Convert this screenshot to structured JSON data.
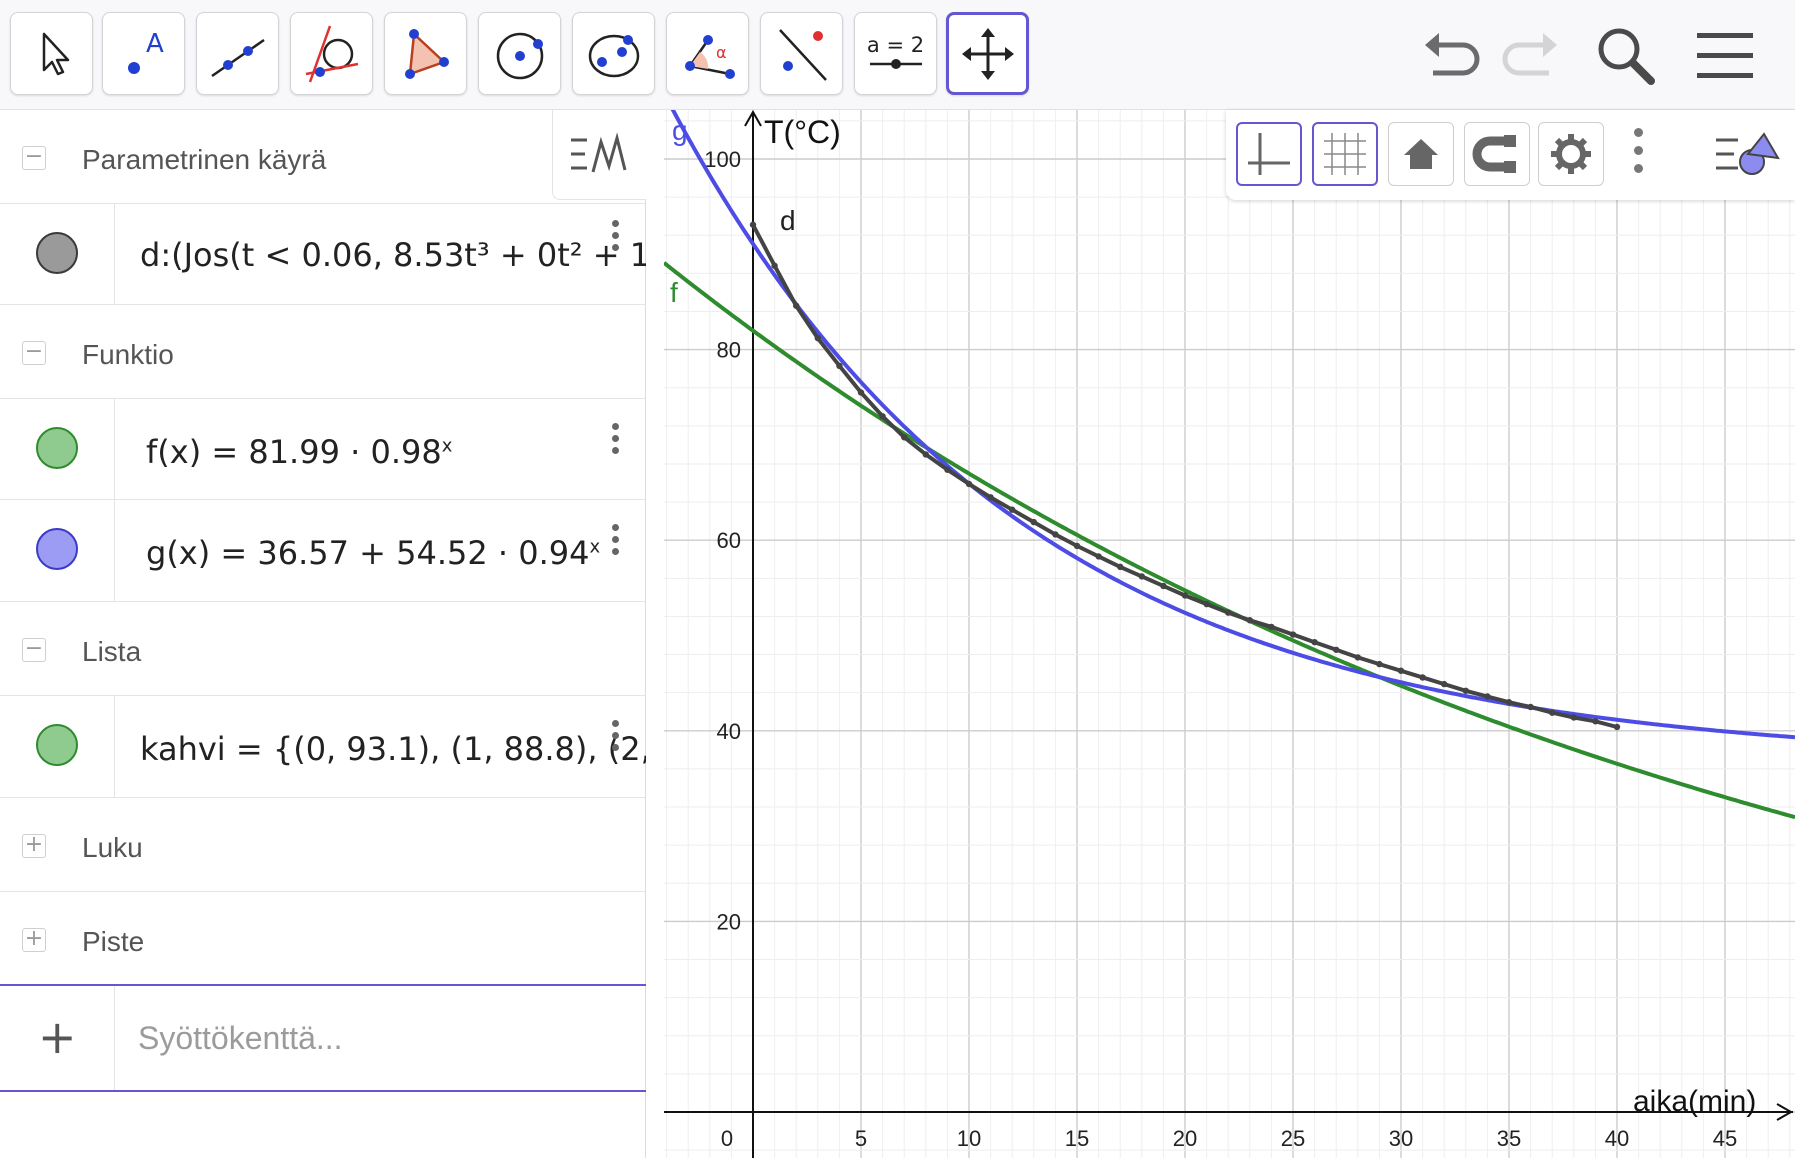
{
  "toolbar": {
    "tools": [
      {
        "name": "move-tool",
        "icon": "arrow-cursor-icon",
        "active": false
      },
      {
        "name": "point-tool",
        "icon": "point-icon",
        "active": false
      },
      {
        "name": "line-tool",
        "icon": "line-icon",
        "active": false
      },
      {
        "name": "tangent-tool",
        "icon": "tangent-icon",
        "active": false
      },
      {
        "name": "polygon-tool",
        "icon": "polygon-icon",
        "active": false
      },
      {
        "name": "circle-tool",
        "icon": "circle-icon",
        "active": false
      },
      {
        "name": "ellipse-tool",
        "icon": "ellipse-icon",
        "active": false
      },
      {
        "name": "angle-tool",
        "icon": "angle-icon",
        "active": false
      },
      {
        "name": "reflect-tool",
        "icon": "reflect-icon",
        "active": false
      },
      {
        "name": "slider-tool",
        "icon": "slider-icon",
        "active": false
      },
      {
        "name": "move-graphics-tool",
        "icon": "move-graphics-icon",
        "active": true
      }
    ],
    "slider_tool_text": "a = 2",
    "angle_tool_text": "α",
    "point_tool_text": "A"
  },
  "algebra": {
    "categories": {
      "parametric": "Parametrinen käyrä",
      "function": "Funktio",
      "list": "Lista",
      "number": "Luku",
      "point": "Piste"
    },
    "items": {
      "d": "d:(Jos(t < 0.06, 8.53t³ + 0t² + 1",
      "f_name": "f",
      "f_body": "(x)  =  81.99 · 0.98",
      "f_exp": "x",
      "g_name": "g",
      "g_body": "(x)  =  36.57 + 54.52 · 0.94",
      "g_exp": "x",
      "kahvi": "kahvi = {(0, 93.1), (1, 88.8), (2,"
    },
    "input_placeholder": "Syöttökenttä..."
  },
  "graph": {
    "x_axis_label": "aika(min)",
    "y_axis_label": "T(°C)",
    "x_ticks": [
      "0",
      "5",
      "10",
      "15",
      "20",
      "25",
      "30",
      "35",
      "40",
      "45"
    ],
    "y_ticks": [
      "20",
      "40",
      "60",
      "80",
      "100"
    ],
    "curve_labels": {
      "g": "g",
      "f": "f",
      "d": "d"
    },
    "colors": {
      "f": "#2e8b2e",
      "g": "#4d4de6",
      "d": "#444444",
      "axis": "#111111",
      "grid_major": "#cccccc",
      "grid_minor": "#eeeeee"
    },
    "functions": {
      "f": {
        "a": 81.99,
        "b": 0.98
      },
      "g": {
        "c": 36.57,
        "a": 54.52,
        "b": 0.94
      }
    },
    "data_points": [
      [
        0,
        93.1
      ],
      [
        1,
        88.8
      ],
      [
        2,
        84.6
      ],
      [
        3,
        81.2
      ],
      [
        4,
        78.3
      ],
      [
        5,
        75.5
      ],
      [
        6,
        73.0
      ],
      [
        7,
        70.8
      ],
      [
        8,
        69.0
      ],
      [
        9,
        67.4
      ],
      [
        10,
        65.9
      ],
      [
        11,
        64.5
      ],
      [
        12,
        63.2
      ],
      [
        13,
        61.9
      ],
      [
        14,
        60.6
      ],
      [
        15,
        59.4
      ],
      [
        16,
        58.3
      ],
      [
        17,
        57.2
      ],
      [
        18,
        56.2
      ],
      [
        19,
        55.2
      ],
      [
        20,
        54.2
      ],
      [
        21,
        53.3
      ],
      [
        22,
        52.4
      ],
      [
        23,
        51.6
      ],
      [
        24,
        50.9
      ],
      [
        25,
        50.1
      ],
      [
        26,
        49.3
      ],
      [
        27,
        48.5
      ],
      [
        28,
        47.7
      ],
      [
        29,
        47.0
      ],
      [
        30,
        46.3
      ],
      [
        31,
        45.6
      ],
      [
        32,
        44.9
      ],
      [
        33,
        44.2
      ],
      [
        34,
        43.6
      ],
      [
        35,
        43.0
      ],
      [
        36,
        42.5
      ],
      [
        37,
        41.9
      ],
      [
        38,
        41.4
      ],
      [
        39,
        41.0
      ],
      [
        40,
        40.4
      ]
    ]
  }
}
